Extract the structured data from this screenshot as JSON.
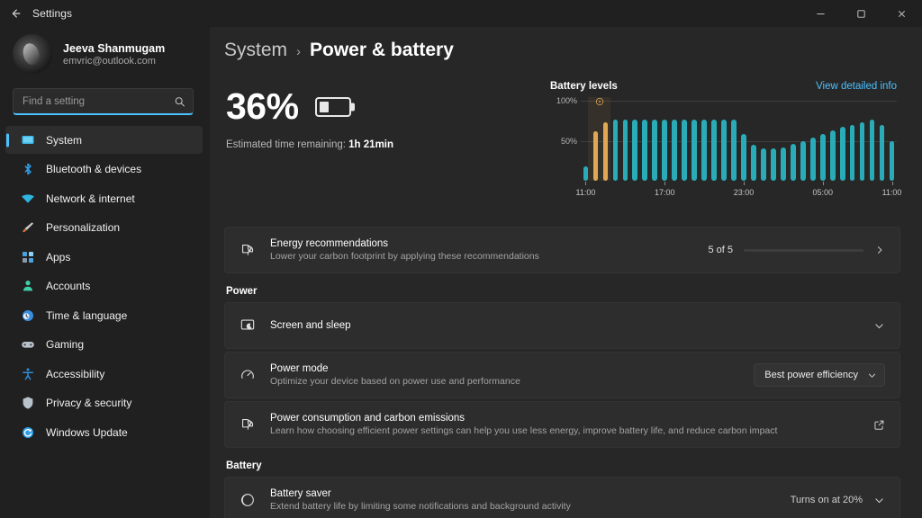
{
  "window": {
    "title": "Settings",
    "back_icon": "back-arrow-icon",
    "minimize_label": "–",
    "maximize_label": "❐",
    "close_label": "✕"
  },
  "account": {
    "name": "Jeeva Shanmugam",
    "email": "emvric@outlook.com"
  },
  "search": {
    "placeholder": "Find a setting",
    "value": ""
  },
  "sidebar": {
    "items": [
      {
        "label": "System",
        "icon": "monitor-icon",
        "color": "#3cb7e8",
        "selected": true
      },
      {
        "label": "Bluetooth & devices",
        "icon": "bluetooth-icon",
        "color": "#2f9fe8",
        "selected": false
      },
      {
        "label": "Network & internet",
        "icon": "wifi-icon",
        "color": "#2fb5e0",
        "selected": false
      },
      {
        "label": "Personalization",
        "icon": "paintbrush-icon",
        "color": "#e07b3a",
        "selected": false
      },
      {
        "label": "Apps",
        "icon": "apps-grid-icon",
        "color": "#4aa3e0",
        "selected": false
      },
      {
        "label": "Accounts",
        "icon": "person-icon",
        "color": "#3fcfa5",
        "selected": false
      },
      {
        "label": "Time & language",
        "icon": "clock-globe-icon",
        "color": "#3a8ee0",
        "selected": false
      },
      {
        "label": "Gaming",
        "icon": "gamepad-icon",
        "color": "#b8c2cc",
        "selected": false
      },
      {
        "label": "Accessibility",
        "icon": "accessibility-person-icon",
        "color": "#2f8fe0",
        "selected": false
      },
      {
        "label": "Privacy & security",
        "icon": "shield-icon",
        "color": "#b8c2cc",
        "selected": false
      },
      {
        "label": "Windows Update",
        "icon": "update-refresh-icon",
        "color": "#2f9fe8",
        "selected": false
      }
    ]
  },
  "header": {
    "crumb_root": "System",
    "crumb_sep": "›",
    "page_title": "Power & battery"
  },
  "battery": {
    "percent_label": "36%",
    "percent_value": 36,
    "icon": "battery-36-icon",
    "estimate_prefix": "Estimated time remaining:",
    "estimate_value": "1h 21min"
  },
  "chart_data": {
    "type": "bar",
    "title": "Battery levels",
    "link_label": "View detailed info",
    "xlabel": "",
    "ylabel": "",
    "ylim": [
      0,
      100
    ],
    "ytick_labels": [
      "100%",
      "50%"
    ],
    "ytick_values": [
      100,
      50
    ],
    "grid": true,
    "legend": false,
    "x_tick_labels": [
      "11:00",
      "17:00",
      "23:00",
      "05:00",
      "11:00"
    ],
    "x_tick_positions": [
      0,
      8,
      16,
      24,
      31
    ],
    "charging_marker_icon": "charging-bolt-icon",
    "charging_band_bars": [
      1,
      2
    ],
    "series": [
      {
        "name": "Battery level",
        "values": [
          18,
          62,
          73,
          76,
          76,
          76,
          76,
          76,
          76,
          76,
          76,
          76,
          76,
          76,
          76,
          76,
          58,
          45,
          41,
          40,
          42,
          46,
          50,
          54,
          58,
          63,
          67,
          70,
          73,
          76,
          70,
          50
        ],
        "states": [
          "discharging",
          "charging",
          "charging",
          "discharging",
          "discharging",
          "discharging",
          "discharging",
          "discharging",
          "discharging",
          "discharging",
          "discharging",
          "discharging",
          "discharging",
          "discharging",
          "discharging",
          "discharging",
          "discharging",
          "discharging",
          "discharging",
          "discharging",
          "discharging",
          "discharging",
          "discharging",
          "discharging",
          "discharging",
          "discharging",
          "discharging",
          "discharging",
          "discharging",
          "discharging",
          "discharging",
          "discharging"
        ]
      }
    ],
    "colors": {
      "discharging": "#2aacb8",
      "charging": "#e0a855",
      "grid": "#3f3f3f"
    }
  },
  "energy_card": {
    "icon": "eco-leaf-icon",
    "title": "Energy recommendations",
    "subtitle": "Lower your carbon footprint by applying these recommendations",
    "count_label": "5 of 5",
    "progress_percent": 100,
    "chevron_icon": "chevron-right-icon"
  },
  "power_section": {
    "heading": "Power",
    "cards": [
      {
        "icon": "screen-sleep-icon",
        "title": "Screen and sleep",
        "subtitle": "",
        "control": "chevron",
        "control_icon": "chevron-down-icon",
        "value": ""
      },
      {
        "icon": "power-mode-gauge-icon",
        "title": "Power mode",
        "subtitle": "Optimize your device based on power use and performance",
        "control": "dropdown",
        "control_icon": "chevron-down-icon",
        "value": "Best power efficiency"
      },
      {
        "icon": "eco-leaf-icon",
        "title": "Power consumption and carbon emissions",
        "subtitle": "Learn how choosing efficient power settings can help you use less energy, improve battery life, and reduce carbon impact",
        "control": "external",
        "control_icon": "external-link-icon",
        "value": ""
      }
    ]
  },
  "battery_section": {
    "heading": "Battery",
    "cards": [
      {
        "icon": "battery-saver-icon",
        "title": "Battery saver",
        "subtitle": "Extend battery life by limiting some notifications and background activity",
        "control": "value-chevron",
        "control_icon": "chevron-down-icon",
        "value": "Turns on at 20%"
      }
    ]
  }
}
